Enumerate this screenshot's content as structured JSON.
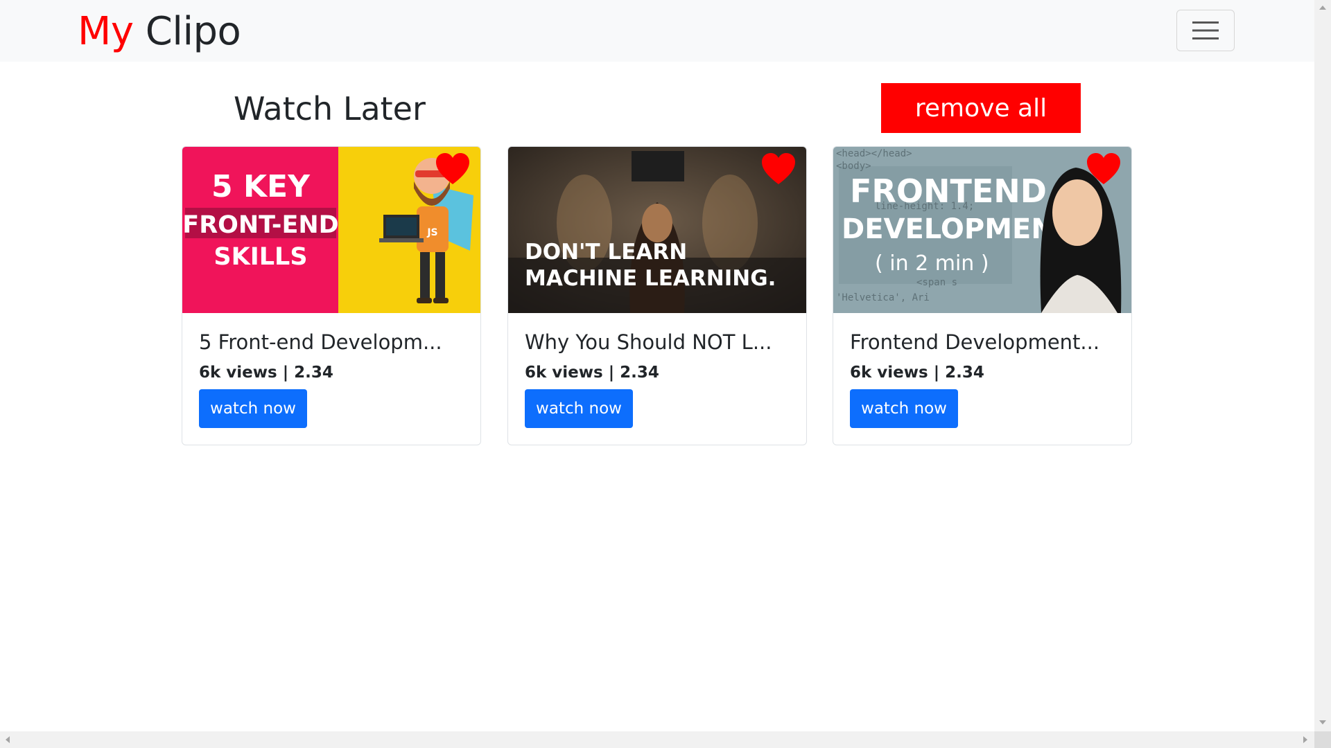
{
  "brand": {
    "part1": "My",
    "part2": "Clipo"
  },
  "nav": {
    "toggler_icon": "hamburger-icon"
  },
  "page": {
    "title": "Watch Later",
    "remove_all_label": "remove all"
  },
  "colors": {
    "brand_accent": "#ff0000",
    "primary_button": "#0d6efd",
    "remove_button": "#ff0000",
    "heart": "#ff0000"
  },
  "videos": [
    {
      "title": "5 Front-end Developm...",
      "meta": "6k views | 2.34",
      "button": "watch now",
      "thumb_text": [
        "5 KEY",
        "FRONT-END",
        "SKILLS"
      ],
      "thumb_badge": "JS"
    },
    {
      "title": "Why You Should NOT L...",
      "meta": "6k views | 2.34",
      "button": "watch now",
      "thumb_text": [
        "DON'T LEARN",
        "MACHINE LEARNING."
      ]
    },
    {
      "title": "Frontend Development...",
      "meta": "6k views | 2.34",
      "button": "watch now",
      "thumb_text": [
        "FRONTEND",
        "DEVELOPMENT",
        "( in 2 min )"
      ],
      "thumb_code": [
        "<head></head>",
        "<body>",
        "line-height: 1.4;",
        "<span s",
        "'Helvetica', Ari"
      ]
    }
  ]
}
